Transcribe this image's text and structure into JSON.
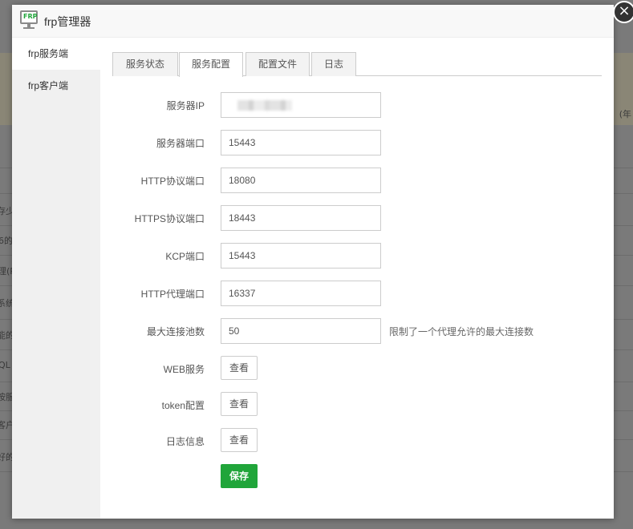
{
  "dialog": {
    "title": "frp管理器",
    "icon_text": "FRP",
    "close_symbol": "×"
  },
  "sidebar": {
    "items": [
      {
        "label": "frp服务端",
        "active": true
      },
      {
        "label": "frp客户端",
        "active": false
      }
    ]
  },
  "tabs": [
    {
      "label": "服务状态",
      "active": false
    },
    {
      "label": "服务配置",
      "active": true
    },
    {
      "label": "配置文件",
      "active": false
    },
    {
      "label": "日志",
      "active": false
    }
  ],
  "form": {
    "server_ip": {
      "label": "服务器IP",
      "value": ""
    },
    "server_port": {
      "label": "服务器端口",
      "value": "15443"
    },
    "http_port": {
      "label": "HTTP协议端口",
      "value": "18080"
    },
    "https_port": {
      "label": "HTTPS协议端口",
      "value": "18443"
    },
    "kcp_port": {
      "label": "KCP端口",
      "value": "15443"
    },
    "http_proxy_port": {
      "label": "HTTP代理端口",
      "value": "16337"
    },
    "max_pool": {
      "label": "最大连接池数",
      "value": "50",
      "hint": "限制了一个代理允许的最大连接数"
    },
    "web_service": {
      "label": "WEB服务",
      "button": "查看"
    },
    "token_config": {
      "label": "token配置",
      "button": "查看"
    },
    "log_info": {
      "label": "日志信息",
      "button": "查看"
    },
    "save_label": "保存"
  },
  "background": {
    "left_fragments": [
      "存少",
      "6的",
      "理(P",
      "系统",
      "能的",
      "QL",
      "按服",
      "客户",
      "好的"
    ],
    "right_fragment": "(年"
  },
  "colors": {
    "accent_green": "#20a53a",
    "overlay": "#7a7a7a"
  }
}
